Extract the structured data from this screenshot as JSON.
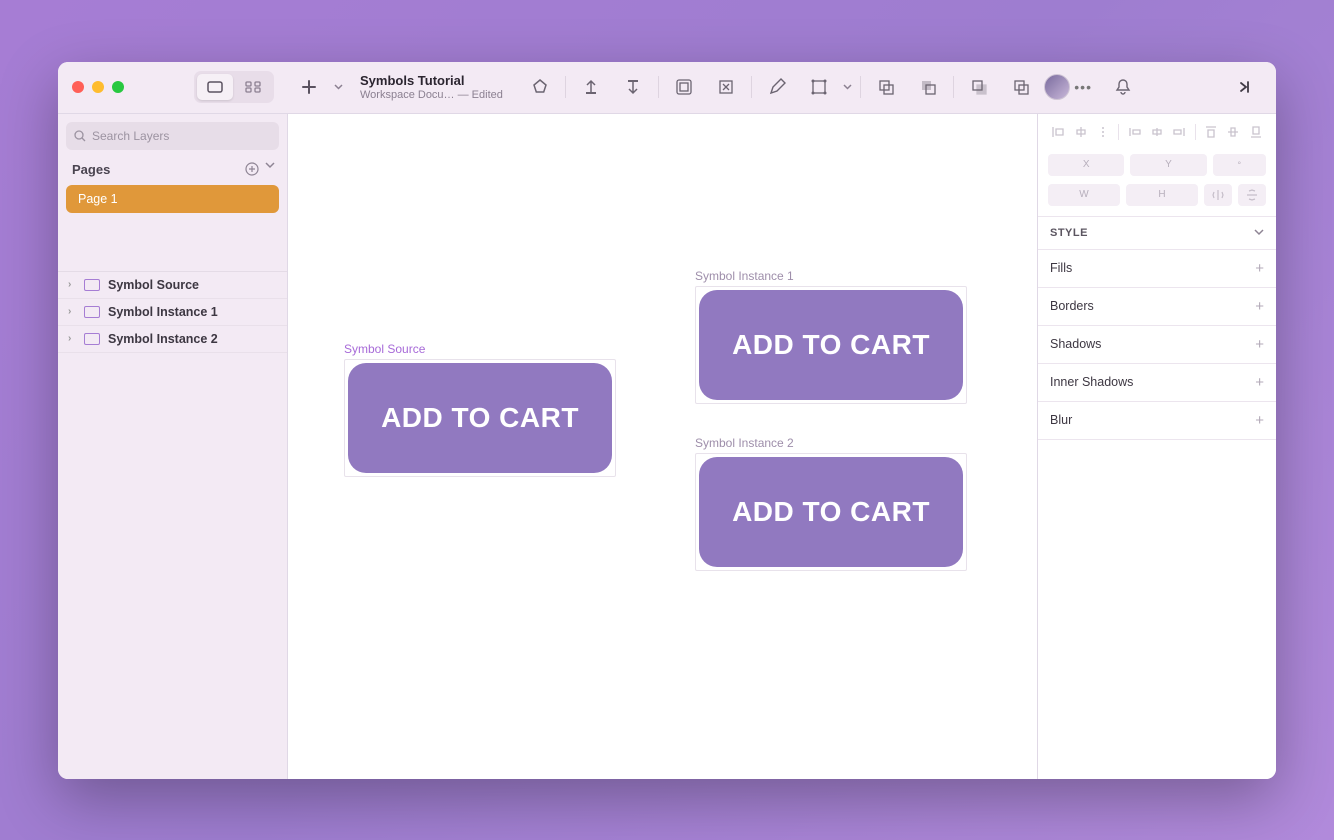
{
  "titlebar": {
    "doc_title": "Symbols Tutorial",
    "doc_subtitle": "Workspace Docu…   —  Edited"
  },
  "left_panel": {
    "search_placeholder": "Search Layers",
    "pages_label": "Pages",
    "page1_label": "Page 1",
    "layers": {
      "0": {
        "label": "Symbol Source"
      },
      "1": {
        "label": "Symbol Instance 1"
      },
      "2": {
        "label": "Symbol Instance 2"
      }
    }
  },
  "canvas": {
    "source": {
      "label": "Symbol Source",
      "button_text": "ADD TO CART"
    },
    "instance1": {
      "label": "Symbol Instance 1",
      "button_text": "ADD TO CART"
    },
    "instance2": {
      "label": "Symbol Instance 2",
      "button_text": "ADD TO CART"
    }
  },
  "right_panel": {
    "dim_x": "X",
    "dim_y": "Y",
    "dim_w": "W",
    "dim_h": "H",
    "style_label": "STYLE",
    "fills_label": "Fills",
    "borders_label": "Borders",
    "shadows_label": "Shadows",
    "inner_shadows_label": "Inner Shadows",
    "blur_label": "Blur"
  }
}
